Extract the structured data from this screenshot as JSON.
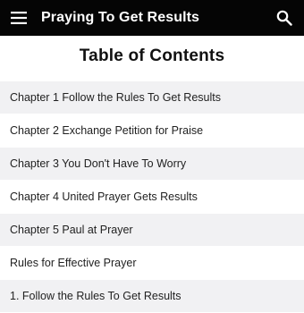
{
  "app_bar": {
    "title": "Praying To Get Results",
    "menu_icon": "hamburger-menu-icon",
    "search_icon": "search-icon",
    "background": "#050505",
    "foreground": "#ffffff"
  },
  "page": {
    "title": "Table of Contents"
  },
  "toc": {
    "items": [
      {
        "label": "Chapter 1 Follow the Rules To Get Results"
      },
      {
        "label": "Chapter 2 Exchange Petition for Praise"
      },
      {
        "label": "Chapter 3 You Don't Have To Worry"
      },
      {
        "label": "Chapter 4 United Prayer Gets Results"
      },
      {
        "label": "Chapter 5 Paul at Prayer"
      },
      {
        "label": "Rules for Effective Prayer"
      },
      {
        "label": "1. Follow the Rules To Get Results"
      }
    ],
    "row_color_a": "#f1f1f3",
    "row_color_b": "#ffffff"
  }
}
